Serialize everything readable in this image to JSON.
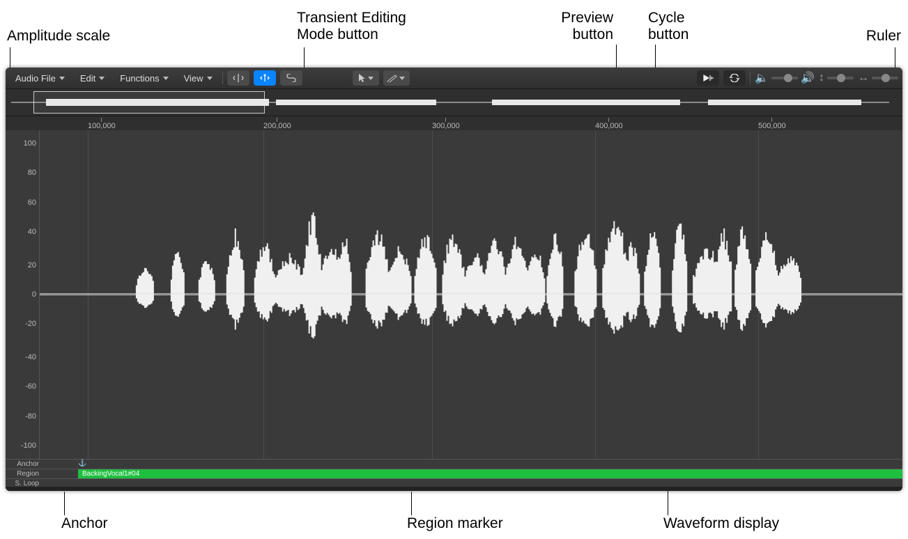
{
  "callouts": {
    "amplitude": "Amplitude scale",
    "transient": "Transient Editing\nMode button",
    "preview": "Preview\nbutton",
    "cycle": "Cycle\nbutton",
    "ruler": "Ruler",
    "anchor": "Anchor",
    "region_marker": "Region marker",
    "waveform_display": "Waveform display"
  },
  "toolbar": {
    "menus": {
      "audio_file": "Audio File",
      "edit": "Edit",
      "functions": "Functions",
      "view": "View"
    },
    "buttons": {
      "transient": "transient-editing",
      "flex": "flex",
      "link": "link",
      "pointer": "pointer",
      "pencil": "pencil",
      "preview": "preview",
      "cycle": "cycle"
    },
    "sliders": {
      "volume": "volume",
      "vertical_zoom": "vertical-zoom",
      "horizontal_zoom": "horizontal-zoom"
    }
  },
  "ruler_ticks": [
    "100,000",
    "200,000",
    "300,000",
    "400,000",
    "500,000"
  ],
  "amplitude_ticks": [
    "100",
    "80",
    "60",
    "40",
    "20",
    "0",
    "-20",
    "-40",
    "-60",
    "-80",
    "-100"
  ],
  "bottom": {
    "anchor": "Anchor",
    "region": "Region",
    "sloop": "S. Loop",
    "region_name": "BackingVocal1#04",
    "anchor_symbol": "⚓"
  },
  "colors": {
    "accent": "#0a84ff",
    "region": "#1fbf3f",
    "wave": "#f0f0f0"
  }
}
